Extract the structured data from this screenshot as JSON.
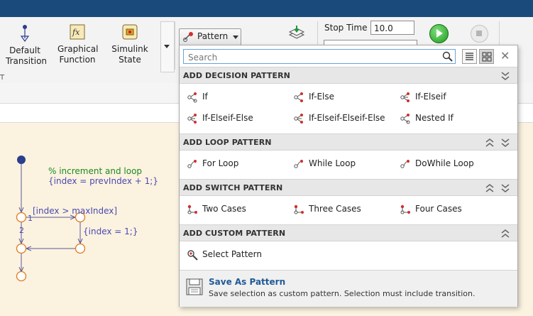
{
  "ribbon": {
    "default_transition": "Default\nTransition",
    "graphical_function": "Graphical\nFunction",
    "simulink_state": "Simulink\nState",
    "section_label": "T",
    "pattern_button": "Pattern",
    "stop_time_label": "Stop Time",
    "stop_time_value": "10.0"
  },
  "popup": {
    "search_placeholder": "Search",
    "sections": {
      "decision": {
        "title": "ADD DECISION PATTERN",
        "items": [
          "If",
          "If-Else",
          "If-Elseif",
          "If-Elseif-Else",
          "If-Elseif-Elseif-Else",
          "Nested If"
        ]
      },
      "loop": {
        "title": "ADD LOOP PATTERN",
        "items": [
          "For Loop",
          "While Loop",
          "DoWhile Loop"
        ]
      },
      "switch": {
        "title": "ADD SWITCH PATTERN",
        "items": [
          "Two Cases",
          "Three Cases",
          "Four Cases"
        ]
      },
      "custom": {
        "title": "ADD CUSTOM PATTERN",
        "items": [
          "Select Pattern"
        ]
      }
    },
    "footer": {
      "title": "Save As Pattern",
      "description": "Save selection as custom pattern. Selection must include transition."
    }
  },
  "diagram": {
    "comment": "% increment and loop",
    "action_init": "{index = prevIndex + 1;}",
    "condition": "[index > maxIndex]",
    "action_reset": "{index = 1;}",
    "order_1": "1",
    "order_2": "2"
  },
  "colors": {
    "title_bar": "#1a4a7c",
    "canvas": "#fbf2e0",
    "junction": "#e07a1a",
    "default_transition_dot": "#2c3e8c",
    "comment_green": "#1d8a1d",
    "action_blue": "#4a4ab0",
    "link_blue": "#1f5a96"
  }
}
